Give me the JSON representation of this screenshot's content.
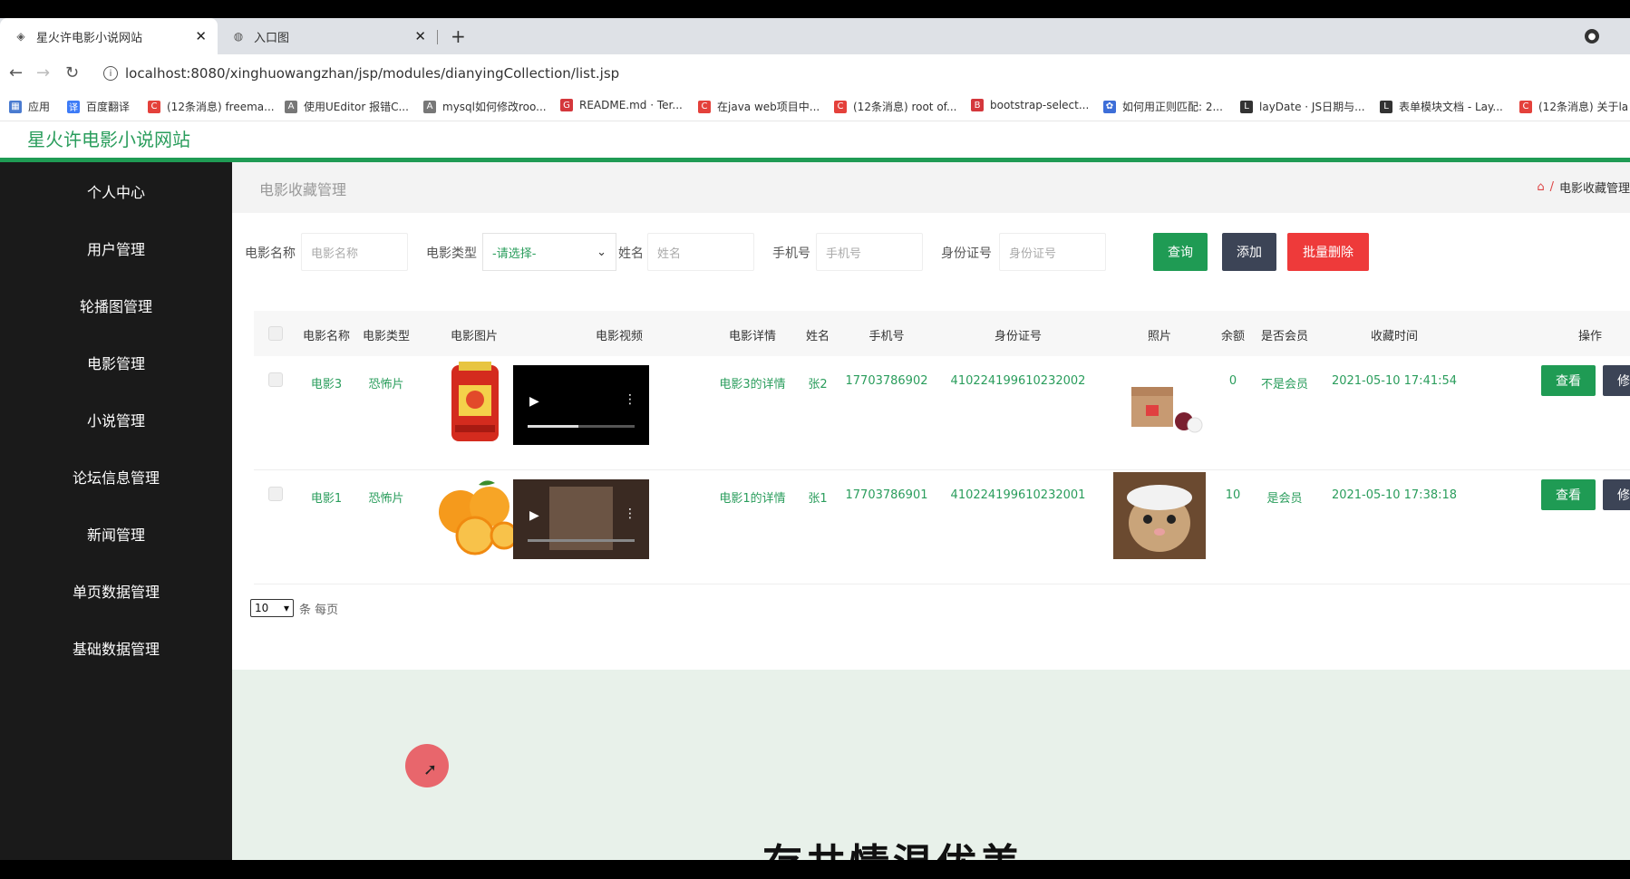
{
  "browser": {
    "tabs": [
      {
        "title": "星火许电影小说网站",
        "active": true
      },
      {
        "title": "入口图",
        "active": false
      }
    ],
    "new_tab": "+",
    "url": "localhost:8080/xinghuowangzhan/jsp/modules/dianyingCollection/list.jsp",
    "bookmarks": [
      {
        "label": "应用",
        "color": "#4a7bd0"
      },
      {
        "label": "百度翻译",
        "color": "#3d7bf7"
      },
      {
        "label": "(12条消息) freema...",
        "color": "#e4413b"
      },
      {
        "label": "使用UEditor 报错C...",
        "color": "#555555"
      },
      {
        "label": "mysql如何修改roo...",
        "color": "#555555"
      },
      {
        "label": "README.md · Ter...",
        "color": "#d4373c"
      },
      {
        "label": "在java web项目中...",
        "color": "#e4413b"
      },
      {
        "label": "(12条消息) root of...",
        "color": "#e4413b"
      },
      {
        "label": "bootstrap-select...",
        "color": "#d4373c"
      },
      {
        "label": "如何用正则匹配: 2...",
        "color": "#3d6ed8"
      },
      {
        "label": "layDate · JS日期与...",
        "color": "#333333"
      },
      {
        "label": "表单模块文档 - Lay...",
        "color": "#333333"
      },
      {
        "label": "(12条消息) 关于la",
        "color": "#e4413b"
      }
    ]
  },
  "site": {
    "brand": "星火许电影小说网站"
  },
  "sidebar": {
    "items": [
      {
        "label": "个人中心"
      },
      {
        "label": "用户管理"
      },
      {
        "label": "轮播图管理"
      },
      {
        "label": "电影管理"
      },
      {
        "label": "小说管理"
      },
      {
        "label": "论坛信息管理"
      },
      {
        "label": "新闻管理"
      },
      {
        "label": "单页数据管理"
      },
      {
        "label": "基础数据管理"
      }
    ]
  },
  "breadcrumb": {
    "title": "电影收藏管理",
    "current": "电影收藏管理",
    "separator": "/"
  },
  "filters": {
    "movie_name": {
      "label": "电影名称",
      "placeholder": "电影名称"
    },
    "movie_type": {
      "label": "电影类型",
      "value": "-请选择-"
    },
    "name": {
      "label": "姓名",
      "placeholder": "姓名"
    },
    "phone": {
      "label": "手机号",
      "placeholder": "手机号"
    },
    "idcard": {
      "label": "身份证号",
      "placeholder": "身份证号"
    },
    "search_btn": "查询",
    "add_btn": "添加",
    "batch_delete_btn": "批量删除",
    "colors": {
      "search": "#1f9b54",
      "add": "#3c4456",
      "delete": "#ee3a3a"
    }
  },
  "table": {
    "headers": [
      "电影名称",
      "电影类型",
      "电影图片",
      "电影视频",
      "电影详情",
      "姓名",
      "手机号",
      "身份证号",
      "照片",
      "余额",
      "是否会员",
      "收藏时间",
      "操作"
    ],
    "rows": [
      {
        "movie_name": "电影3",
        "movie_type": "恐怖片",
        "detail": "电影3的详情",
        "name": "张2",
        "phone": "17703786902",
        "idcard": "410224199610232002",
        "balance": "0",
        "member": "不是会员",
        "time": "2021-05-10 17:41:54",
        "view": "查看",
        "edit": "修改"
      },
      {
        "movie_name": "电影1",
        "movie_type": "恐怖片",
        "detail": "电影1的详情",
        "name": "张1",
        "phone": "17703786901",
        "idcard": "410224199610232001",
        "balance": "10",
        "member": "是会员",
        "time": "2021-05-10 17:38:18",
        "view": "查看",
        "edit": "修改"
      }
    ]
  },
  "pager": {
    "page_size": "10",
    "suffix": "条 每页"
  },
  "lower": {
    "bigtext": "存共情温优美"
  }
}
